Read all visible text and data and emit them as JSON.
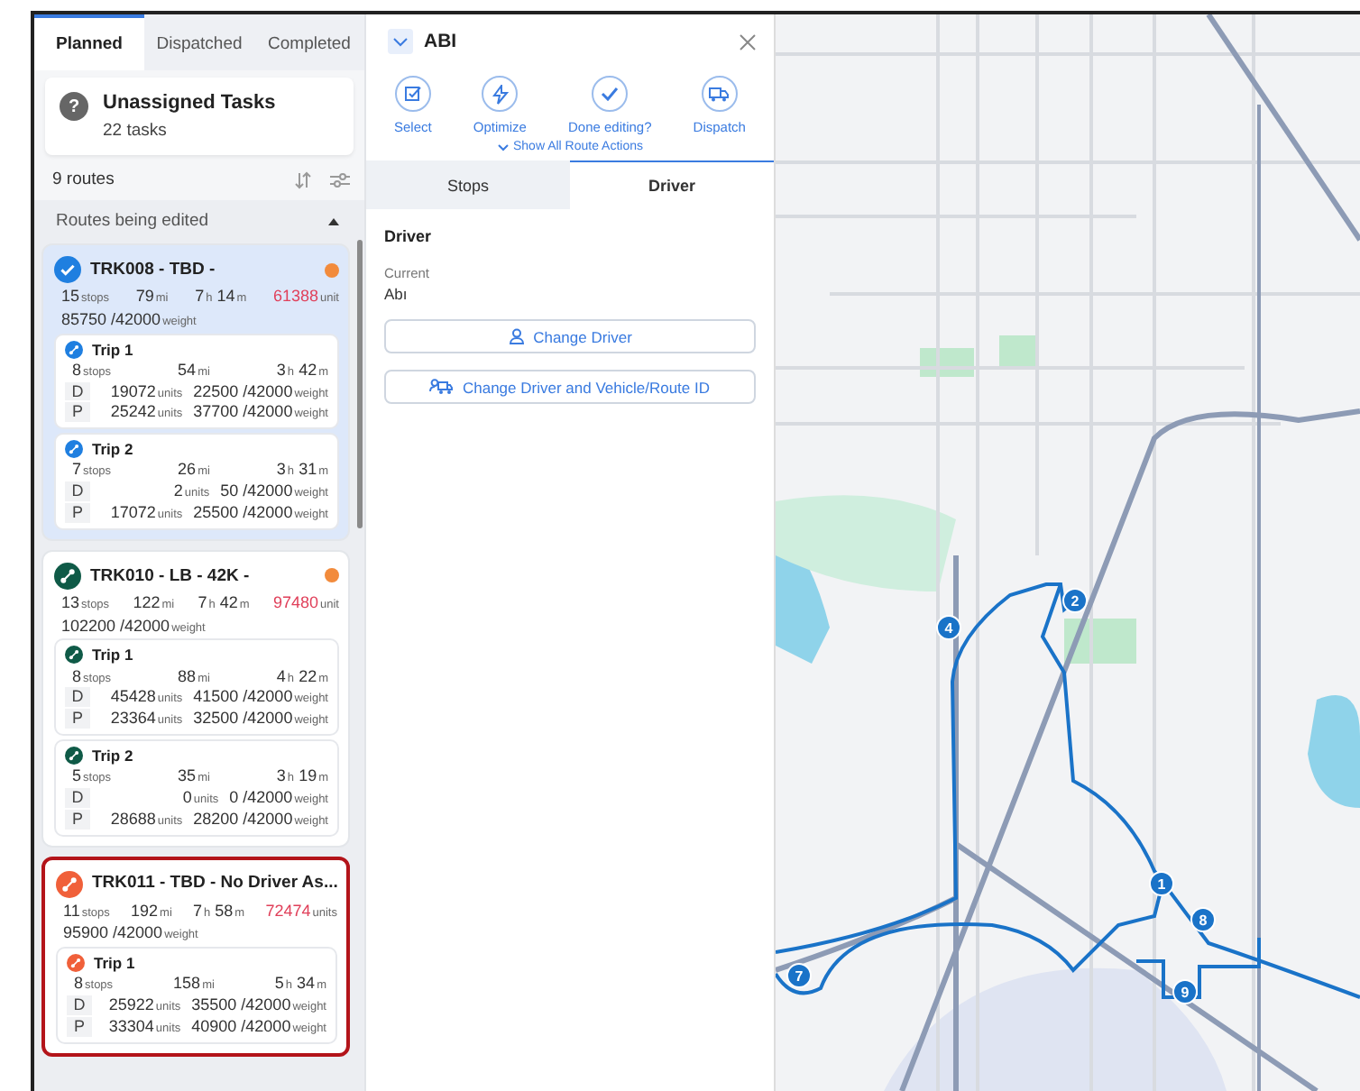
{
  "sidebar": {
    "tabs": [
      {
        "label": "Planned",
        "selected": true
      },
      {
        "label": "Dispatched",
        "selected": false
      },
      {
        "label": "Completed",
        "selected": false
      }
    ],
    "unassigned": {
      "icon": "?",
      "title": "Unassigned Tasks",
      "count": "22 tasks"
    },
    "route_count": "9 routes",
    "section": {
      "title": "Routes being edited",
      "expanded": true
    },
    "routes": [
      {
        "name": "TRK008 - TBD -",
        "selected": true,
        "alert": true,
        "highlighted": false,
        "color": "#1f7fe0",
        "stops": {
          "value": "15",
          "unit": "stops"
        },
        "distance": {
          "value": "79",
          "unit": "mi"
        },
        "duration": [
          {
            "value": "7",
            "unit": "h"
          },
          {
            "value": "14",
            "unit": "m"
          }
        ],
        "units": {
          "value": "61388",
          "unit": "unit"
        },
        "weight": {
          "value": "85750 /42000",
          "unit": "weight"
        },
        "trips": [
          {
            "name": "Trip 1",
            "stops": {
              "value": "8",
              "unit": "stops"
            },
            "distance": {
              "value": "54",
              "unit": "mi"
            },
            "duration": [
              {
                "value": "3",
                "unit": "h"
              },
              {
                "value": "42",
                "unit": "m"
              }
            ],
            "rows": [
              {
                "label": "D",
                "units": {
                  "value": "19072",
                  "unit": "units"
                },
                "weight": {
                  "value": "22500 /42000",
                  "unit": "weight"
                }
              },
              {
                "label": "P",
                "units": {
                  "value": "25242",
                  "unit": "units"
                },
                "weight": {
                  "value": "37700 /42000",
                  "unit": "weight"
                }
              }
            ]
          },
          {
            "name": "Trip 2",
            "stops": {
              "value": "7",
              "unit": "stops"
            },
            "distance": {
              "value": "26",
              "unit": "mi"
            },
            "duration": [
              {
                "value": "3",
                "unit": "h"
              },
              {
                "value": "31",
                "unit": "m"
              }
            ],
            "rows": [
              {
                "label": "D",
                "units": {
                  "value": "2",
                  "unit": "units"
                },
                "weight": {
                  "value": "50 /42000",
                  "unit": "weight"
                }
              },
              {
                "label": "P",
                "units": {
                  "value": "17072",
                  "unit": "units"
                },
                "weight": {
                  "value": "25500 /42000",
                  "unit": "weight"
                }
              }
            ]
          }
        ]
      },
      {
        "name": "TRK010 - LB - 42K -",
        "selected": false,
        "alert": true,
        "highlighted": false,
        "color": "#0f5a47",
        "stops": {
          "value": "13",
          "unit": "stops"
        },
        "distance": {
          "value": "122",
          "unit": "mi"
        },
        "duration": [
          {
            "value": "7",
            "unit": "h"
          },
          {
            "value": "42",
            "unit": "m"
          }
        ],
        "units": {
          "value": "97480",
          "unit": "unit"
        },
        "weight": {
          "value": "102200 /42000",
          "unit": "weight"
        },
        "trips": [
          {
            "name": "Trip 1",
            "stops": {
              "value": "8",
              "unit": "stops"
            },
            "distance": {
              "value": "88",
              "unit": "mi"
            },
            "duration": [
              {
                "value": "4",
                "unit": "h"
              },
              {
                "value": "22",
                "unit": "m"
              }
            ],
            "rows": [
              {
                "label": "D",
                "units": {
                  "value": "45428",
                  "unit": "units"
                },
                "weight": {
                  "value": "41500 /42000",
                  "unit": "weight"
                }
              },
              {
                "label": "P",
                "units": {
                  "value": "23364",
                  "unit": "units"
                },
                "weight": {
                  "value": "32500 /42000",
                  "unit": "weight"
                }
              }
            ]
          },
          {
            "name": "Trip 2",
            "stops": {
              "value": "5",
              "unit": "stops"
            },
            "distance": {
              "value": "35",
              "unit": "mi"
            },
            "duration": [
              {
                "value": "3",
                "unit": "h"
              },
              {
                "value": "19",
                "unit": "m"
              }
            ],
            "rows": [
              {
                "label": "D",
                "units": {
                  "value": "0",
                  "unit": "units"
                },
                "weight": {
                  "value": "0 /42000",
                  "unit": "weight"
                }
              },
              {
                "label": "P",
                "units": {
                  "value": "28688",
                  "unit": "units"
                },
                "weight": {
                  "value": "28200 /42000",
                  "unit": "weight"
                }
              }
            ]
          }
        ]
      },
      {
        "name": "TRK011 - TBD - No Driver As...",
        "selected": false,
        "alert": false,
        "highlighted": true,
        "color": "#f0603a",
        "stops": {
          "value": "11",
          "unit": "stops"
        },
        "distance": {
          "value": "192",
          "unit": "mi"
        },
        "duration": [
          {
            "value": "7",
            "unit": "h"
          },
          {
            "value": "58",
            "unit": "m"
          }
        ],
        "units": {
          "value": "72474",
          "unit": "units"
        },
        "weight": {
          "value": "95900 /42000",
          "unit": "weight"
        },
        "trips": [
          {
            "name": "Trip 1",
            "stops": {
              "value": "8",
              "unit": "stops"
            },
            "distance": {
              "value": "158",
              "unit": "mi"
            },
            "duration": [
              {
                "value": "5",
                "unit": "h"
              },
              {
                "value": "34",
                "unit": "m"
              }
            ],
            "rows": [
              {
                "label": "D",
                "units": {
                  "value": "25922",
                  "unit": "units"
                },
                "weight": {
                  "value": "35500 /42000",
                  "unit": "weight"
                }
              },
              {
                "label": "P",
                "units": {
                  "value": "33304",
                  "unit": "units"
                },
                "weight": {
                  "value": "40900 /42000",
                  "unit": "weight"
                }
              }
            ]
          }
        ]
      }
    ]
  },
  "editor": {
    "title": "ABI",
    "actions": [
      {
        "kind": "select",
        "label": "Select"
      },
      {
        "kind": "optimize",
        "label": "Optimize"
      },
      {
        "kind": "done",
        "label": "Done editing?"
      },
      {
        "kind": "dispatch",
        "label": "Dispatch"
      }
    ],
    "show_all": "Show All Route Actions",
    "tabs": [
      {
        "label": "Stops",
        "selected": false
      },
      {
        "label": "Driver",
        "selected": true
      }
    ],
    "driver": {
      "heading": "Driver",
      "current_label": "Current",
      "current_value": "Abı"
    },
    "buttons": [
      {
        "kind": "person",
        "label": "Change Driver"
      },
      {
        "kind": "vehicle",
        "label": "Change Driver and Vehicle/Route ID"
      }
    ]
  },
  "map": {
    "pins": [
      {
        "label": "2"
      },
      {
        "label": "4"
      },
      {
        "label": "1"
      },
      {
        "label": "8"
      },
      {
        "label": "9"
      },
      {
        "label": "7"
      }
    ]
  }
}
